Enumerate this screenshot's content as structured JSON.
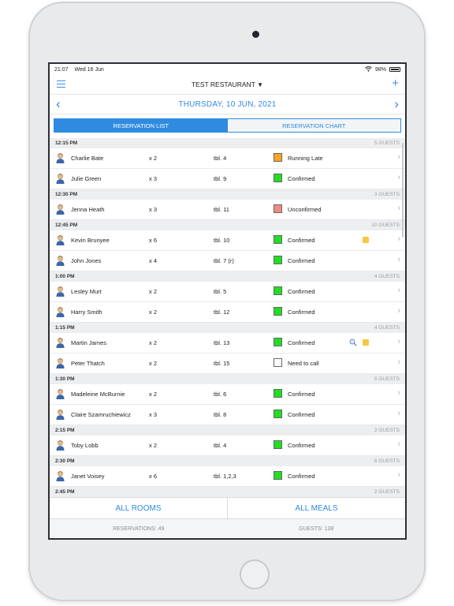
{
  "status": {
    "time": "21:07",
    "date": "Wed 16 Jun",
    "battery": "98%"
  },
  "nav": {
    "title": "TEST RESTAURANT"
  },
  "date_bar": {
    "label": "THURSDAY, 10 JUN, 2021"
  },
  "tabs": [
    {
      "label": "RESERVATION LIST",
      "active": true
    },
    {
      "label": "RESERVATION CHART",
      "active": false
    }
  ],
  "sections": [
    {
      "time": "12:15 PM",
      "guests": "5 GUESTS",
      "rows": [
        {
          "name": "Charlie Bate",
          "qty": "x 2",
          "table": "tbl. 4",
          "status": "Running Late",
          "color": "#f5a623"
        },
        {
          "name": "Julie Green",
          "qty": "x 3",
          "table": "tbl. 9",
          "status": "Confirmed",
          "color": "#22dd22"
        }
      ]
    },
    {
      "time": "12:30 PM",
      "guests": "3 GUESTS",
      "rows": [
        {
          "name": "Jenna Heath",
          "qty": "x 3",
          "table": "tbl. 11",
          "status": "Unconfirmed",
          "color": "#f08a86"
        }
      ]
    },
    {
      "time": "12:45 PM",
      "guests": "10 GUESTS",
      "rows": [
        {
          "name": "Kevin Brunyee",
          "qty": "x 6",
          "table": "tbl. 10",
          "status": "Confirmed",
          "color": "#22dd22",
          "note": true
        },
        {
          "name": "John Jones",
          "qty": "x 4",
          "table": "tbl. 7 (r)",
          "status": "Confirmed",
          "color": "#22dd22"
        }
      ]
    },
    {
      "time": "1:00 PM",
      "guests": "4 GUESTS",
      "rows": [
        {
          "name": "Lesley Murt",
          "qty": "x 2",
          "table": "tbl. 5",
          "status": "Confirmed",
          "color": "#22dd22"
        },
        {
          "name": "Harry Smith",
          "qty": "x 2",
          "table": "tbl. 12",
          "status": "Confirmed",
          "color": "#22dd22"
        }
      ]
    },
    {
      "time": "1:15 PM",
      "guests": "4 GUESTS",
      "rows": [
        {
          "name": "Martin James",
          "qty": "x 2",
          "table": "tbl. 13",
          "status": "Confirmed",
          "color": "#22dd22",
          "note": true,
          "search": true
        },
        {
          "name": "Peter Thatch",
          "qty": "x 2",
          "table": "tbl. 15",
          "status": "Need to call",
          "color": "#ffffff"
        }
      ]
    },
    {
      "time": "1:30 PM",
      "guests": "5 GUESTS",
      "rows": [
        {
          "name": "Madeleine McBurnie",
          "qty": "x 2",
          "table": "tbl. 6",
          "status": "Confirmed",
          "color": "#22dd22"
        },
        {
          "name": "Claire Szamruchiewicz",
          "qty": "x 3",
          "table": "tbl. 8",
          "status": "Confirmed",
          "color": "#22dd22"
        }
      ]
    },
    {
      "time": "2:15 PM",
      "guests": "2 GUESTS",
      "rows": [
        {
          "name": "Toby Lobb",
          "qty": "x 2",
          "table": "tbl. 4",
          "status": "Confirmed",
          "color": "#22dd22"
        }
      ]
    },
    {
      "time": "2:30 PM",
      "guests": "6 GUESTS",
      "rows": [
        {
          "name": "Janet Voisey",
          "qty": "x 6",
          "table": "tbl. 1,2,3",
          "status": "Confirmed",
          "color": "#22dd22"
        }
      ]
    },
    {
      "time": "2:45 PM",
      "guests": "2 GUESTS",
      "rows": []
    }
  ],
  "footer": {
    "rooms_label": "ALL ROOMS",
    "meals_label": "ALL MEALS",
    "reservations": "RESERVATIONS: 49",
    "guests": "GUESTS: 138"
  },
  "icons": {
    "menu": "hamburger-menu-icon",
    "add": "plus-icon",
    "prev": "chevron-left-icon",
    "next": "chevron-right-icon",
    "avatar": "person-avatar-icon",
    "note": "sticky-note-icon",
    "search": "search-icon"
  }
}
